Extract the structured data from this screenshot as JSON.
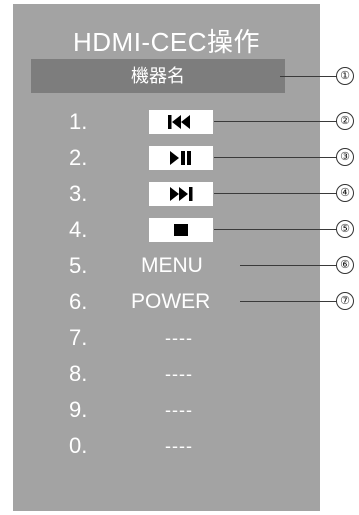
{
  "title": "HDMI-CEC操作",
  "device_name": "機器名",
  "rows": [
    {
      "num": "1.",
      "kind": "icon",
      "icon": "skip-back-icon"
    },
    {
      "num": "2.",
      "kind": "icon",
      "icon": "play-pause-icon"
    },
    {
      "num": "3.",
      "kind": "icon",
      "icon": "skip-forward-icon"
    },
    {
      "num": "4.",
      "kind": "icon",
      "icon": "stop-icon"
    },
    {
      "num": "5.",
      "kind": "text",
      "label": "MENU"
    },
    {
      "num": "6.",
      "kind": "text",
      "label": "POWER"
    },
    {
      "num": "7.",
      "kind": "dash",
      "label": "----"
    },
    {
      "num": "8.",
      "kind": "dash",
      "label": "----"
    },
    {
      "num": "9.",
      "kind": "dash",
      "label": "----"
    },
    {
      "num": "0.",
      "kind": "dash",
      "label": "----"
    }
  ],
  "callouts": [
    "①",
    "②",
    "③",
    "④",
    "⑤",
    "⑥",
    "⑦"
  ]
}
